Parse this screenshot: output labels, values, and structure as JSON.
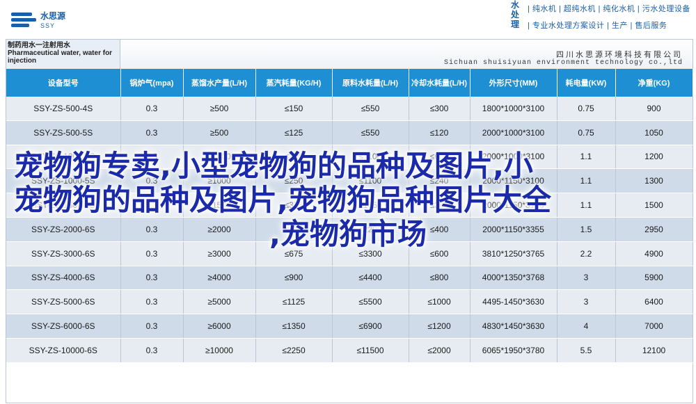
{
  "header": {
    "logo_text": "水思源",
    "logo_sub": "SSY",
    "brand_vertical": [
      "水",
      "处",
      "理"
    ],
    "brand_line1": "| 纯水机 | 超纯水机 | 纯化水机 | 污水处理设备",
    "brand_line2": "| 专业水处理方案设计 | 生产 | 售后服务"
  },
  "table": {
    "title_left": [
      "制药用水一注射用水",
      "Pharmaceutical water, water for",
      "injection"
    ],
    "company_cn": "四川水思源环境科技有限公司",
    "company_en": "Sichuan shuisiyuan environment technology co.,ltd",
    "columns": [
      "设备型号",
      "锅炉气(mpa)",
      "蒸馏水产量(L/H)",
      "蒸汽耗量(KG/H)",
      "原料水耗量(L/H)",
      "冷却水耗量(L/H)",
      "外形尺寸(MM)",
      "耗电量(KW)",
      "净重(KG)"
    ],
    "rows": [
      [
        "SSY-ZS-500-4S",
        "0.3",
        "≥500",
        "≤150",
        "≤550",
        "≤300",
        "1800*1000*3100",
        "0.75",
        "900"
      ],
      [
        "SSY-ZS-500-5S",
        "0.3",
        "≥500",
        "≤125",
        "≤550",
        "≤120",
        "2000*1000*3100",
        "0.75",
        "1050"
      ],
      [
        "SSY-ZS-1000-4S",
        "0.3",
        "≥1000",
        "≤300",
        "≤1100",
        "≤600",
        "2000*1000*3100",
        "1.1",
        "1200"
      ],
      [
        "SSY-ZS-1000-5S",
        "0.3",
        "≥1000",
        "≤250",
        "≤1100",
        "≤240",
        "2000*1150*3100",
        "1.1",
        "1300"
      ],
      [
        "SSY-ZS-1500-5S",
        "0.3",
        "≥1500",
        "≤375",
        "≤1650",
        "≤360",
        "2000*1150*3100",
        "1.1",
        "1500"
      ],
      [
        "SSY-ZS-2000-6S",
        "0.3",
        "≥2000",
        "≤450",
        "≤2200",
        "≤400",
        "2000*1150*3355",
        "1.5",
        "2950"
      ],
      [
        "SSY-ZS-3000-6S",
        "0.3",
        "≥3000",
        "≤675",
        "≤3300",
        "≤600",
        "3810*1250*3765",
        "2.2",
        "4900"
      ],
      [
        "SSY-ZS-4000-6S",
        "0.3",
        "≥4000",
        "≤900",
        "≤4400",
        "≤800",
        "4000*1350*3768",
        "3",
        "5900"
      ],
      [
        "SSY-ZS-5000-6S",
        "0.3",
        "≥5000",
        "≤1125",
        "≤5500",
        "≤1000",
        "4495-1450*3630",
        "3",
        "6400"
      ],
      [
        "SSY-ZS-6000-6S",
        "0.3",
        "≥6000",
        "≤1350",
        "≤6900",
        "≤1200",
        "4830*1450*3630",
        "4",
        "7000"
      ],
      [
        "SSY-ZS-10000-6S",
        "0.3",
        "≥10000",
        "≤2250",
        "≤11500",
        "≤2000",
        "6065*1950*3780",
        "5.5",
        "12100"
      ]
    ]
  },
  "overlay": {
    "line1": "宠物狗专卖,小型宠物狗的品种及图片,小",
    "line2": "宠物狗的品种及图片,宠物狗品种图片大全",
    "line3": ",宠物狗市场"
  },
  "colors": {
    "header_blue": "#1f8fd3",
    "row_light": "#e7ecf3",
    "row_dark": "#cfdbe9",
    "overlay_text": "#1a2aa8"
  }
}
